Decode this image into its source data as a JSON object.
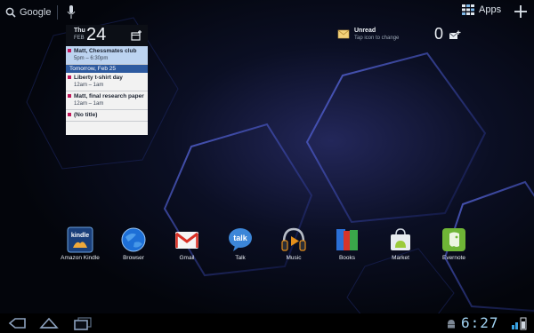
{
  "search": {
    "label": "Google"
  },
  "top": {
    "apps_label": "Apps"
  },
  "calendar": {
    "dow": "Thu",
    "month": "FEB",
    "day": "24",
    "events": [
      {
        "title": "Matt, Chessmates club",
        "time": "5pm – 6:30pm",
        "selected": true
      },
      {
        "title": "Liberty t-shirt day",
        "time": "12am – 1am",
        "selected": false
      },
      {
        "title": "Matt, final research paper",
        "time": "12am – 1am",
        "selected": false
      },
      {
        "title": "(No title)",
        "time": "",
        "selected": false
      }
    ],
    "day_header": "Tomorrow, Feb 25"
  },
  "gmail": {
    "title": "Unread",
    "subtitle": "Tap icon to change",
    "count": "0"
  },
  "dock": {
    "apps": [
      {
        "label": "Amazon Kindle",
        "icon": "kindle-icon"
      },
      {
        "label": "Browser",
        "icon": "browser-globe-icon"
      },
      {
        "label": "Gmail",
        "icon": "gmail-icon"
      },
      {
        "label": "Talk",
        "icon": "talk-icon"
      },
      {
        "label": "Music",
        "icon": "music-headphones-icon"
      },
      {
        "label": "Books",
        "icon": "books-icon"
      },
      {
        "label": "Market",
        "icon": "market-bag-icon"
      },
      {
        "label": "Evernote",
        "icon": "evernote-icon"
      }
    ]
  },
  "system": {
    "time": "6:27"
  },
  "colors": {
    "accent": "#3aa3e3",
    "calendar_blue": "#2d5aa0",
    "calendar_marker": "#c2185b"
  }
}
